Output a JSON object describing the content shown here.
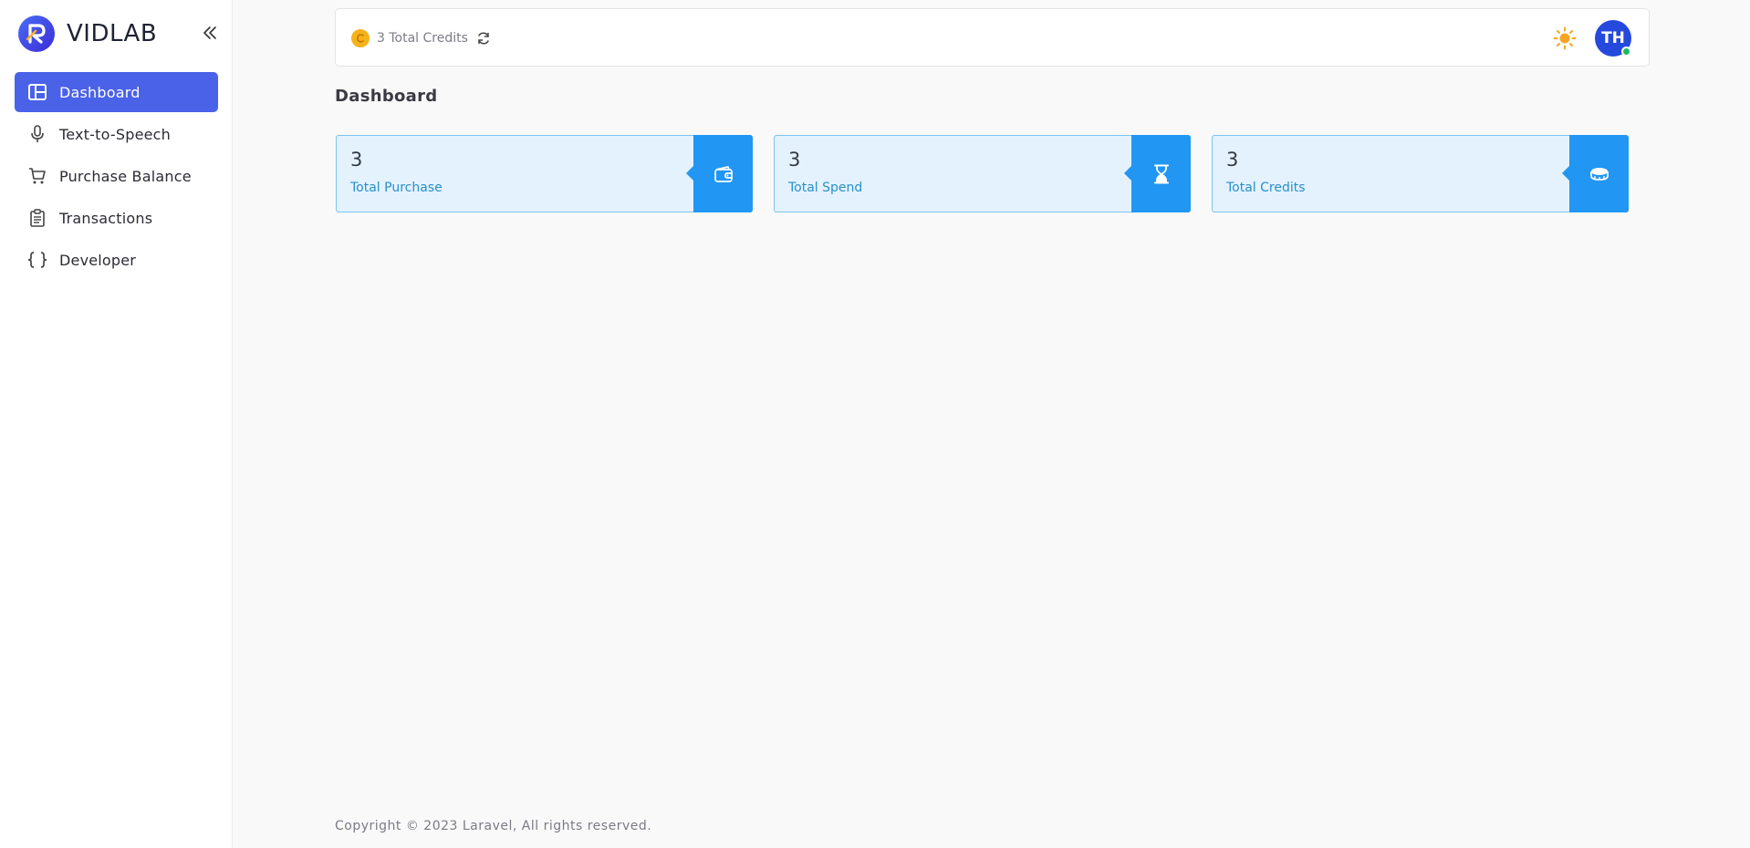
{
  "brand": {
    "name": "VIDLAB",
    "logo_letter": "R"
  },
  "sidebar": {
    "items": [
      {
        "label": "Dashboard",
        "icon": "dashboard-icon",
        "active": true
      },
      {
        "label": "Text-to-Speech",
        "icon": "microphone-icon",
        "active": false
      },
      {
        "label": "Purchase Balance",
        "icon": "cart-icon",
        "active": false
      },
      {
        "label": "Transactions",
        "icon": "clipboard-icon",
        "active": false
      },
      {
        "label": "Developer",
        "icon": "braces-icon",
        "active": false
      }
    ]
  },
  "topbar": {
    "credits_text": "3 Total Credits",
    "avatar_initials": "TH"
  },
  "page": {
    "title": "Dashboard"
  },
  "cards": [
    {
      "value": "3",
      "label": "Total Purchase",
      "icon": "wallet-icon"
    },
    {
      "value": "3",
      "label": "Total Spend",
      "icon": "hourglass-icon"
    },
    {
      "value": "3",
      "label": "Total Credits",
      "icon": "coins-icon"
    }
  ],
  "footer": {
    "text": "Copyright © 2023 Laravel, All rights reserved."
  },
  "colors": {
    "accent": "#4a62e8",
    "card_bg": "#e3f2fd",
    "card_icon_bg": "#2196f3",
    "coin": "#f6b21b",
    "online": "#1fb865"
  }
}
